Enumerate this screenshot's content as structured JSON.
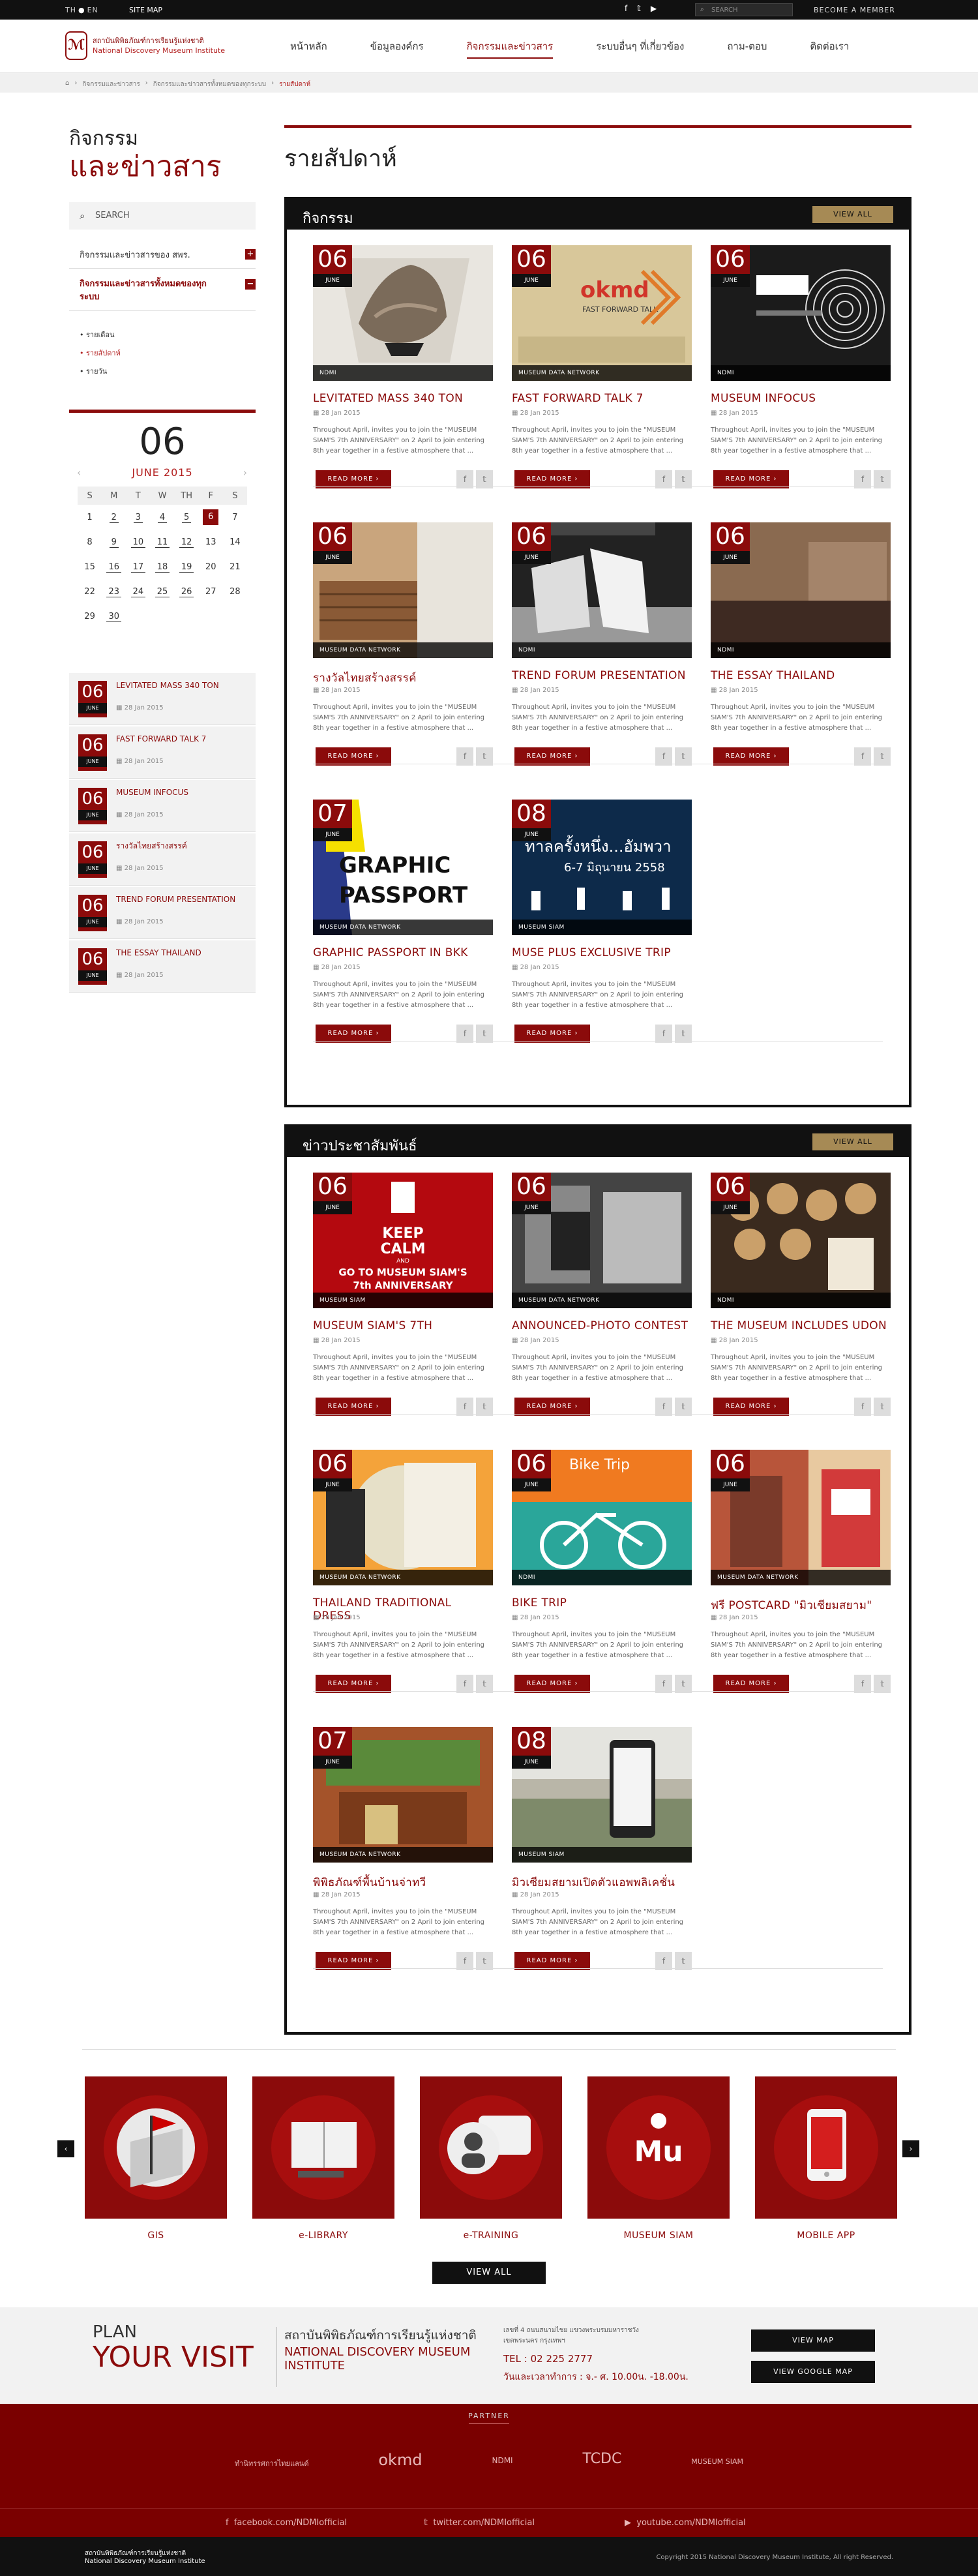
{
  "topbar": {
    "lang_th": "TH",
    "lang_en": "EN",
    "sitemap": "SITE MAP",
    "search_placeholder": "SEARCH",
    "member": "BECOME A MEMBER"
  },
  "logo": {
    "th": "สถาบันพิพิธภัณฑ์การเรียนรู้แห่งชาติ",
    "en": "National Discovery Museum Institute"
  },
  "nav": [
    "หน้าหลัก",
    "ข้อมูลองค์กร",
    "กิจกรรมและข่าวสาร",
    "ระบบอื่นๆ ที่เกี่ยวข้อง",
    "ถาม-ตอบ",
    "ติดต่อเรา"
  ],
  "breadcrumb": [
    "กิจกรรมและข่าวสาร",
    "กิจกรรมและข่าวสารทั้งหมดของทุกระบบ",
    "รายสัปดาห์"
  ],
  "sidebar": {
    "title_1": "กิจกรรม",
    "title_2": "และข่าวสาร",
    "search": "SEARCH",
    "cat_1": "กิจกรรมและข่าวสารของ สพร.",
    "cat_2": "กิจกรรมและข่าวสารทั้งหมดของทุกระบบ",
    "sub": [
      "รายเดือน",
      "รายสัปดาห์",
      "รายวัน"
    ],
    "cal_day": "06",
    "cal_month": "JUNE 2015",
    "weekdays": [
      "S",
      "M",
      "T",
      "W",
      "TH",
      "F",
      "S"
    ],
    "weeks": [
      [
        "1",
        "2",
        "3",
        "4",
        "5",
        "6",
        "7"
      ],
      [
        "8",
        "9",
        "10",
        "11",
        "12",
        "13",
        "14"
      ],
      [
        "15",
        "16",
        "17",
        "18",
        "19",
        "20",
        "21"
      ],
      [
        "22",
        "23",
        "24",
        "25",
        "26",
        "27",
        "28"
      ],
      [
        "29",
        "30",
        "",
        "",
        "",
        "",
        ""
      ]
    ],
    "events": [
      {
        "day": "06",
        "month": "JUNE",
        "title": "LEVITATED MASS 340 TON",
        "date": "28 Jan 2015"
      },
      {
        "day": "06",
        "month": "JUNE",
        "title": "FAST FORWARD TALK 7",
        "date": "28 Jan 2015"
      },
      {
        "day": "06",
        "month": "JUNE",
        "title": "MUSEUM INFOCUS",
        "date": "28 Jan 2015"
      },
      {
        "day": "06",
        "month": "JUNE",
        "title": "รางวัลไทยสร้างสรรค์",
        "date": "28 Jan 2015"
      },
      {
        "day": "06",
        "month": "JUNE",
        "title": "TREND FORUM PRESENTATION",
        "date": "28 Jan 2015"
      },
      {
        "day": "06",
        "month": "JUNE",
        "title": "THE ESSAY THAILAND",
        "date": "28 Jan 2015"
      }
    ]
  },
  "main": {
    "title": "รายสัปดาห์"
  },
  "excerpt": "Throughout April, invites you to join the \"MUSEUM SIAM'S 7th ANNIVERSARY\" on 2 April to join entering 8th year together in a festive atmosphere that ...",
  "read_more": "READ MORE  ›",
  "view_all": "VIEW ALL",
  "activities": {
    "heading": "กิจกรรม",
    "items": [
      {
        "day": "06",
        "month": "JUNE",
        "source": "NDMI",
        "title": "LEVITATED MASS 340 TON",
        "date": "28 Jan 2015"
      },
      {
        "day": "06",
        "month": "JUNE",
        "source": "MUSEUM DATA NETWORK",
        "title": "FAST FORWARD TALK 7",
        "date": "28 Jan 2015"
      },
      {
        "day": "06",
        "month": "JUNE",
        "source": "NDMI",
        "title": "MUSEUM INFOCUS",
        "date": "28 Jan 2015"
      },
      {
        "day": "06",
        "month": "JUNE",
        "source": "MUSEUM DATA NETWORK",
        "title": "รางวัลไทยสร้างสรรค์",
        "date": "28 Jan 2015"
      },
      {
        "day": "06",
        "month": "JUNE",
        "source": "NDMI",
        "title": "TREND FORUM PRESENTATION",
        "date": "28 Jan 2015"
      },
      {
        "day": "06",
        "month": "JUNE",
        "source": "NDMI",
        "title": "THE ESSAY THAILAND",
        "date": "28 Jan 2015"
      },
      {
        "day": "07",
        "month": "JUNE",
        "source": "MUSEUM DATA NETWORK",
        "title": "GRAPHIC PASSPORT IN BKK",
        "date": "28 Jan 2015"
      },
      {
        "day": "08",
        "month": "JUNE",
        "source": "MUSEUM SIAM",
        "title": "MUSE PLUS EXCLUSIVE TRIP",
        "date": "28 Jan 2015"
      }
    ]
  },
  "news": {
    "heading": "ข่าวประชาสัมพันธ์",
    "items": [
      {
        "day": "06",
        "month": "JUNE",
        "source": "MUSEUM SIAM",
        "title": "MUSEUM SIAM'S 7TH",
        "date": "28 Jan 2015"
      },
      {
        "day": "06",
        "month": "JUNE",
        "source": "MUSEUM DATA NETWORK",
        "title": "ANNOUNCED-PHOTO CONTEST",
        "date": "28 Jan 2015"
      },
      {
        "day": "06",
        "month": "JUNE",
        "source": "NDMI",
        "title": "THE MUSEUM INCLUDES UDON",
        "date": "28 Jan 2015"
      },
      {
        "day": "06",
        "month": "JUNE",
        "source": "MUSEUM DATA NETWORK",
        "title": "THAILAND TRADITIONAL DRESS",
        "date": "28 Jan 2015"
      },
      {
        "day": "06",
        "month": "JUNE",
        "source": "NDMI",
        "title": "BIKE TRIP",
        "date": "28 Jan 2015"
      },
      {
        "day": "06",
        "month": "JUNE",
        "source": "MUSEUM DATA NETWORK",
        "title": "ฟรี POSTCARD \"มิวเซียมสยาม\"",
        "date": "28 Jan 2015"
      },
      {
        "day": "07",
        "month": "JUNE",
        "source": "MUSEUM DATA NETWORK",
        "title": "พิพิธภัณฑ์พื้นบ้านจ่าทวี",
        "date": "28 Jan 2015"
      },
      {
        "day": "08",
        "month": "JUNE",
        "source": "MUSEUM SIAM",
        "title": "มิวเซียมสยามเปิดตัวแอพพลิเคชั่น",
        "date": "28 Jan 2015"
      }
    ]
  },
  "image_text": {
    "fft": "FAST FORWARD TALK",
    "okmd": "okmd",
    "graphic": "GRAPHIC",
    "passport": "PASSPORT",
    "keep": "KEEP",
    "calm": "CALM",
    "and": "AND",
    "go": "GO TO MUSEUM SIAM'S",
    "anniv": "7th ANNIVERSARY",
    "bike": "Bike Trip",
    "muse_thai": "ทาลครั้งหนึ่ง...อัมพวา",
    "muse_date": "6-7 มิถุนายน 2558"
  },
  "quicklinks": [
    "GIS",
    "e-LIBRARY",
    "e-TRAINING",
    "MUSEUM SIAM",
    "MOBILE APP"
  ],
  "quick_view_all": "VIEW ALL",
  "plan": {
    "a": "PLAN",
    "b": "YOUR VISIT",
    "th_name": "สถาบันพิพิธภัณฑ์การเรียนรู้แห่งชาติ",
    "en_name_1": "NATIONAL DISCOVERY MUSEUM",
    "en_name_2": "INSTITUTE",
    "addr_1": "เลขที่ 4 ถนนสนามไชย แขวงพระบรมมหาราชวัง",
    "addr_2": "เขตพระนคร กรุงเทพฯ",
    "tel": "TEL : 02 225 2777",
    "hours": "วันและเวลาทำการ : จ.- ศ. 10.00น. -18.00น.",
    "btn_map": "VIEW MAP",
    "btn_gmap": "VIEW GOOGLE MAP"
  },
  "partner": {
    "title": "PARTNER",
    "logos": [
      "ทำนิทรรศการไทยแลนด์",
      "okmd",
      "NDMI",
      "TCDC",
      "MUSEUM SIAM"
    ]
  },
  "social": {
    "fb": "facebook.com/NDMIofficial",
    "tw": "twitter.com/NDMIofficial",
    "yt": "youtube.com/NDMIofficial"
  },
  "footer": {
    "logo_th": "สถาบันพิพิธภัณฑ์การเรียนรู้แห่งชาติ",
    "logo_en": "National Discovery Museum Institute",
    "copyright": "Copyright 2015 National Discovery Museum Institute, All right Reserved."
  }
}
